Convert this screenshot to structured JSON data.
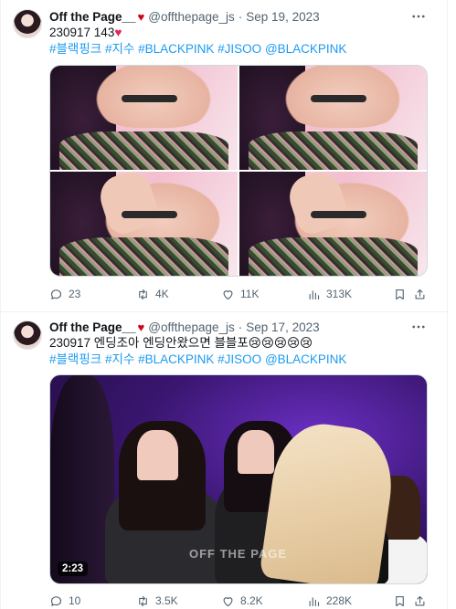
{
  "tweets": [
    {
      "author_name": "Off the Page__",
      "heart": "♥",
      "handle": "@offthepage_js",
      "dot": "·",
      "date": "Sep 19, 2023",
      "text": "230917 143",
      "text_heart": "♥",
      "hashtags": [
        "#블랙핑크",
        "#지수",
        "#BLACKPINK",
        "#JISOO",
        "@BLACKPINK"
      ],
      "media": "photos",
      "photo_count": 4,
      "stats": {
        "replies": "23",
        "retweets": "4K",
        "likes": "11K",
        "views": "313K"
      }
    },
    {
      "author_name": "Off the Page__",
      "heart": "♥",
      "handle": "@offthepage_js",
      "dot": "·",
      "date": "Sep 17, 2023",
      "text": "230917 엔딩조아 엔딩안왔으면 블블포",
      "emoji": "😢😢😢😢😢",
      "hashtags": [
        "#블랙핑크",
        "#지수",
        "#BLACKPINK",
        "#JISOO",
        "@BLACKPINK"
      ],
      "media": "video",
      "video_duration": "2:23",
      "video_watermark": "OFF THE PAGE",
      "stats": {
        "replies": "10",
        "retweets": "3.5K",
        "likes": "8.2K",
        "views": "228K"
      }
    }
  ],
  "icons": {
    "more": "more-icon",
    "reply": "reply-icon",
    "retweet": "retweet-icon",
    "like": "heart-icon",
    "views": "views-icon",
    "bookmark": "bookmark-icon",
    "share": "share-icon"
  },
  "colors": {
    "link": "#1d9bf0",
    "secondary_text": "#536471",
    "heart": "#d0021b"
  }
}
